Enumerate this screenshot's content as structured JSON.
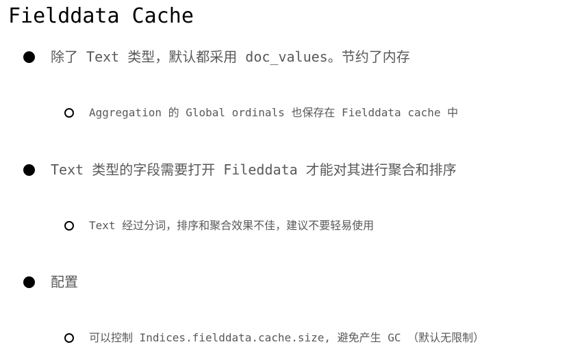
{
  "title": "Fielddata Cache",
  "items": [
    {
      "text": "除了 Text 类型，默认都采用 doc_values。节约了内存",
      "sub": "Aggregation 的 Global ordinals 也保存在 Fielddata cache 中"
    },
    {
      "text": "Text 类型的字段需要打开 Fileddata 才能对其进行聚合和排序",
      "sub": "Text 经过分词，排序和聚合效果不佳，建议不要轻易使用"
    },
    {
      "text": "配置",
      "sub": "可以控制 Indices.fielddata.cache.size, 避免产生 GC （默认无限制）"
    }
  ]
}
